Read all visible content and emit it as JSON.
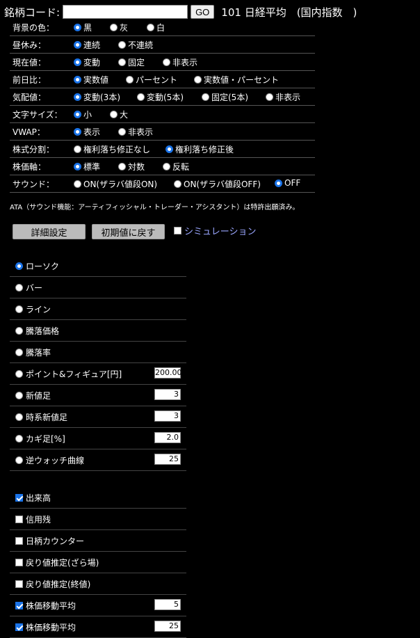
{
  "codebar": {
    "label": "銘柄コード:",
    "go": "GO",
    "title": "101 日経平均　(国内指数　)"
  },
  "settings": [
    {
      "label": "背景の色：",
      "options": [
        "黒",
        "灰",
        "白"
      ],
      "selected": 0
    },
    {
      "label": "昼休み：",
      "options": [
        "連続",
        "不連続"
      ],
      "selected": 0
    },
    {
      "label": "現在値：",
      "options": [
        "変動",
        "固定",
        "非表示"
      ],
      "selected": 0
    },
    {
      "label": "前日比：",
      "options": [
        "実数値",
        "パーセント",
        "実数値・パーセント"
      ],
      "selected": 0
    },
    {
      "label": "気配値：",
      "options": [
        "変動(3本)",
        "変動(5本)",
        "固定(5本)",
        "非表示"
      ],
      "selected": 0
    },
    {
      "label": "文字サイズ：",
      "options": [
        "小",
        "大"
      ],
      "selected": 0
    },
    {
      "label": "VWAP：",
      "options": [
        "表示",
        "非表示"
      ],
      "selected": 0
    },
    {
      "label": "株式分割：",
      "options": [
        "権利落ち修正なし",
        "権利落ち修正後"
      ],
      "selected": 1
    },
    {
      "label": "株価軸：",
      "options": [
        "標準",
        "対数",
        "反転"
      ],
      "selected": 0
    },
    {
      "label": "サウンド：",
      "options": [
        "ON(ザラバ値段ON)",
        "ON(ザラバ値段OFF)",
        "OFF"
      ],
      "selected": 2
    }
  ],
  "note": "ATA（サウンド機能：アーティフィッシャル・トレーダー・アシスタント）は特許出願済み。",
  "buttons": {
    "detail": "詳細設定",
    "reset": "初期値に戻す",
    "simulation": "シミュレーション"
  },
  "chart_types": [
    {
      "label": "ローソク",
      "selected": true
    },
    {
      "label": "バー"
    },
    {
      "label": "ライン"
    },
    {
      "label": "騰落価格"
    },
    {
      "label": "騰落率"
    },
    {
      "label": "ポイント&フィギュア[円]",
      "value": "200.00"
    },
    {
      "label": "新値足",
      "value": "3"
    },
    {
      "label": "時系新値足",
      "value": "3"
    },
    {
      "label": "カギ足[%]",
      "value": "2.0"
    },
    {
      "label": "逆ウォッチ曲線",
      "value": "25"
    }
  ],
  "indicators": [
    {
      "label": "出来高",
      "checked": true
    },
    {
      "label": "信用残",
      "checked": false
    },
    {
      "label": "日柄カウンター",
      "checked": false
    },
    {
      "label": "戻り値推定(ざら場)",
      "checked": false
    },
    {
      "label": "戻り値推定(終値)",
      "checked": false
    },
    {
      "label": "株価移動平均",
      "checked": true,
      "value": "5"
    },
    {
      "label": "株価移動平均",
      "checked": true,
      "value": "25"
    }
  ]
}
